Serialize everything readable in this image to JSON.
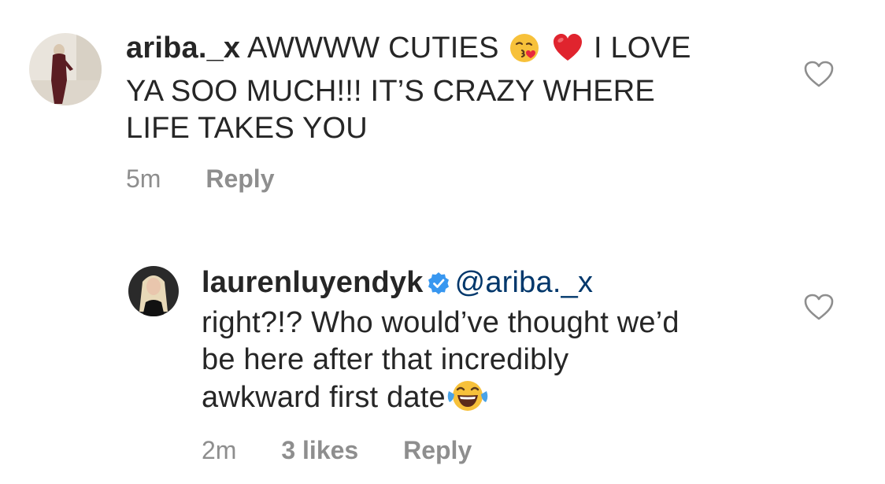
{
  "comments": [
    {
      "username": "ariba._x",
      "text_line1_a": "AWWWW CUTIES",
      "text_line1_b": "I LOVE",
      "text_line2": "YA SOO MUCH!!! IT’S CRAZY WHERE",
      "text_line3": "LIFE TAKES YOU",
      "emoji_1": "kissing-face-with-heart-icon",
      "emoji_2": "red-heart-icon",
      "time": "5m",
      "reply_label": "Reply",
      "like_icon": "heart-outline-icon"
    },
    {
      "username": "laurenluyendyk",
      "verified": true,
      "mention": "@ariba._x",
      "text_line2": "right?!? Who would’ve thought we’d",
      "text_line3": "be here after that incredibly",
      "text_line4": "awkward first date",
      "emoji_1": "face-with-tears-of-joy-icon",
      "time": "2m",
      "likes": "3 likes",
      "reply_label": "Reply",
      "like_icon": "heart-outline-icon"
    }
  ],
  "colors": {
    "text": "#262626",
    "meta": "#8e8e8e",
    "mention": "#00376b",
    "verified_badge": "#3897f0"
  }
}
